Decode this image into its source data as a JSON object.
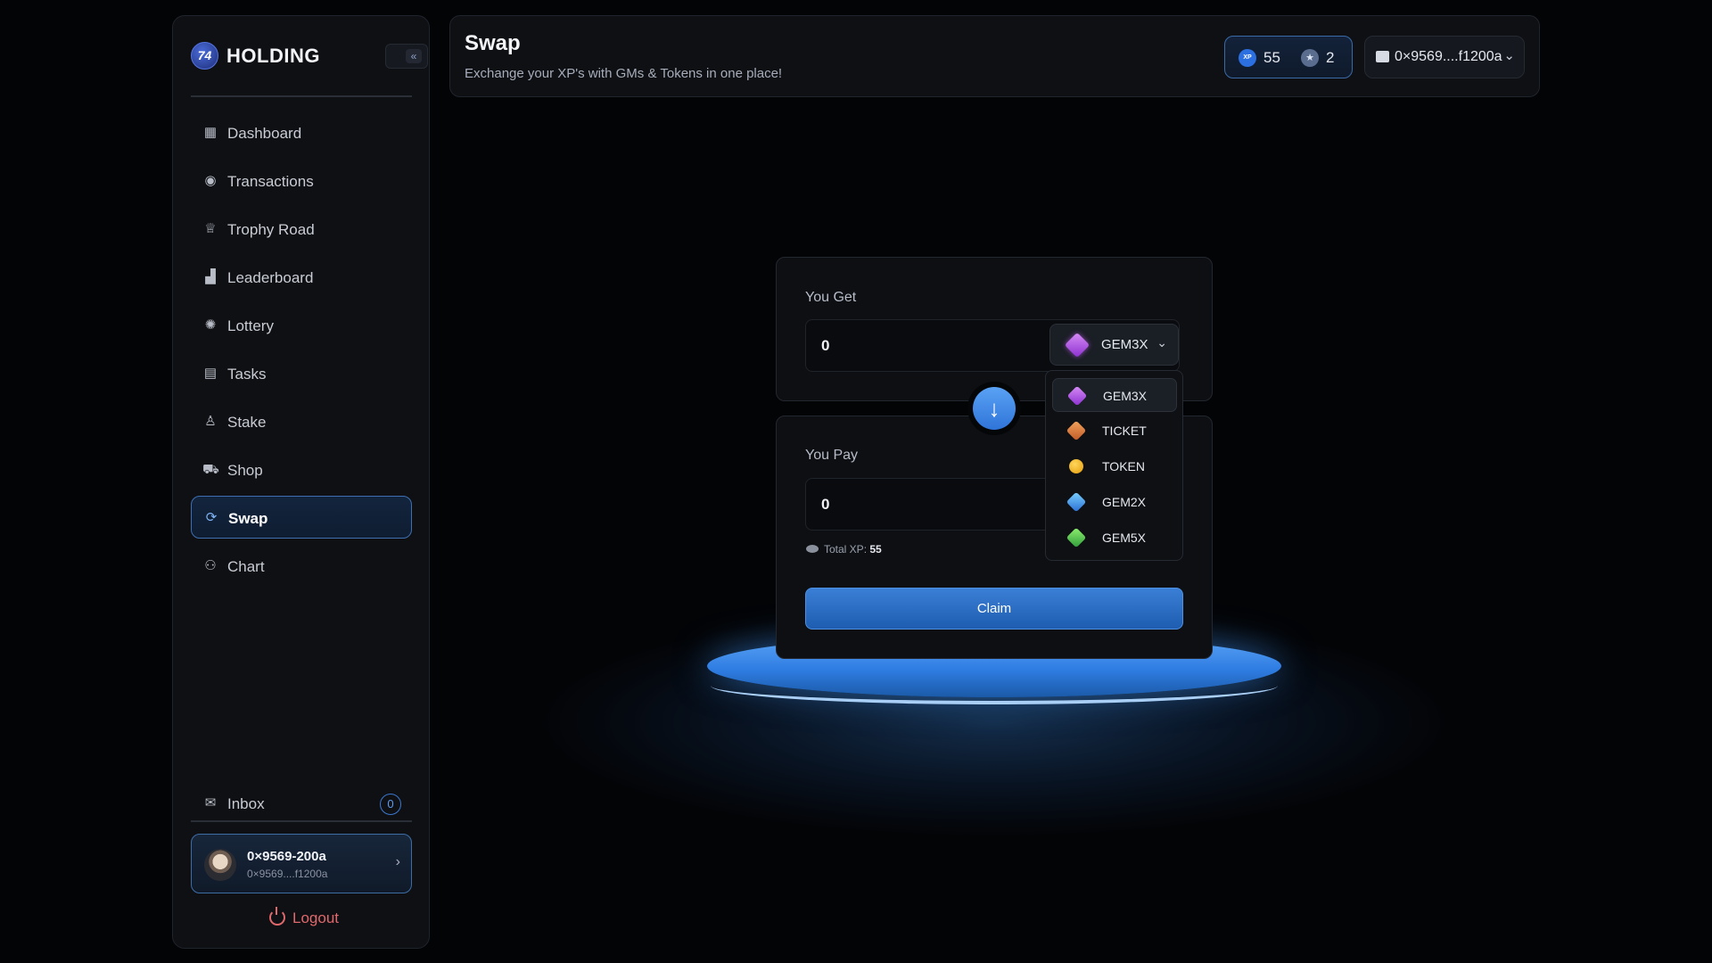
{
  "brand": {
    "name": "HOLDING",
    "logo_text": "74"
  },
  "sidebar": {
    "collapse_icon": "«",
    "items": [
      {
        "label": "Dashboard",
        "icon": "grid-icon",
        "glyph": "▦"
      },
      {
        "label": "Transactions",
        "icon": "coins-icon",
        "glyph": "◉"
      },
      {
        "label": "Trophy Road",
        "icon": "trophy-icon",
        "glyph": "♕"
      },
      {
        "label": "Leaderboard",
        "icon": "podium-icon",
        "glyph": "▟"
      },
      {
        "label": "Lottery",
        "icon": "lottery-icon",
        "glyph": "✺"
      },
      {
        "label": "Tasks",
        "icon": "file-icon",
        "glyph": "▤"
      },
      {
        "label": "Stake",
        "icon": "stake-icon",
        "glyph": "♙"
      },
      {
        "label": "Shop",
        "icon": "cart-icon",
        "glyph": "⛟"
      },
      {
        "label": "Swap",
        "icon": "swap-icon",
        "glyph": "⟳"
      },
      {
        "label": "Chart",
        "icon": "chart-icon",
        "glyph": "⚇"
      }
    ],
    "active": "Swap",
    "inbox": {
      "label": "Inbox",
      "count": "0",
      "glyph": "✉"
    },
    "user": {
      "name": "0×9569-200a",
      "address": "0×9569....f1200a"
    },
    "logout_label": "Logout"
  },
  "header": {
    "title": "Swap",
    "subtitle": "Exchange your XP's with GMs & Tokens in one place!",
    "xp_icon_text": "XP",
    "xp_value": "55",
    "stars_value": "2",
    "wallet_address": "0×9569....f1200a"
  },
  "swap": {
    "get_label": "You Get",
    "get_amount": "0",
    "selected_token": "GEM3X",
    "pay_label": "You Pay",
    "pay_amount": "0",
    "total_xp_label": "Total XP:",
    "total_xp_value": "55",
    "claim_label": "Claim",
    "arrow_glyph": "↓"
  },
  "token_options": [
    {
      "label": "GEM3X",
      "icon": "gem3x-icon",
      "selected": true
    },
    {
      "label": "TICKET",
      "icon": "ticket-icon",
      "selected": false
    },
    {
      "label": "TOKEN",
      "icon": "token-icon",
      "selected": false
    },
    {
      "label": "GEM2X",
      "icon": "gem2x-icon",
      "selected": false
    },
    {
      "label": "GEM5X",
      "icon": "gem5x-icon",
      "selected": false
    }
  ],
  "colors": {
    "accent": "#3a7fd6",
    "background": "#030406",
    "panel": "#0e1014",
    "logout": "#e0686b"
  }
}
